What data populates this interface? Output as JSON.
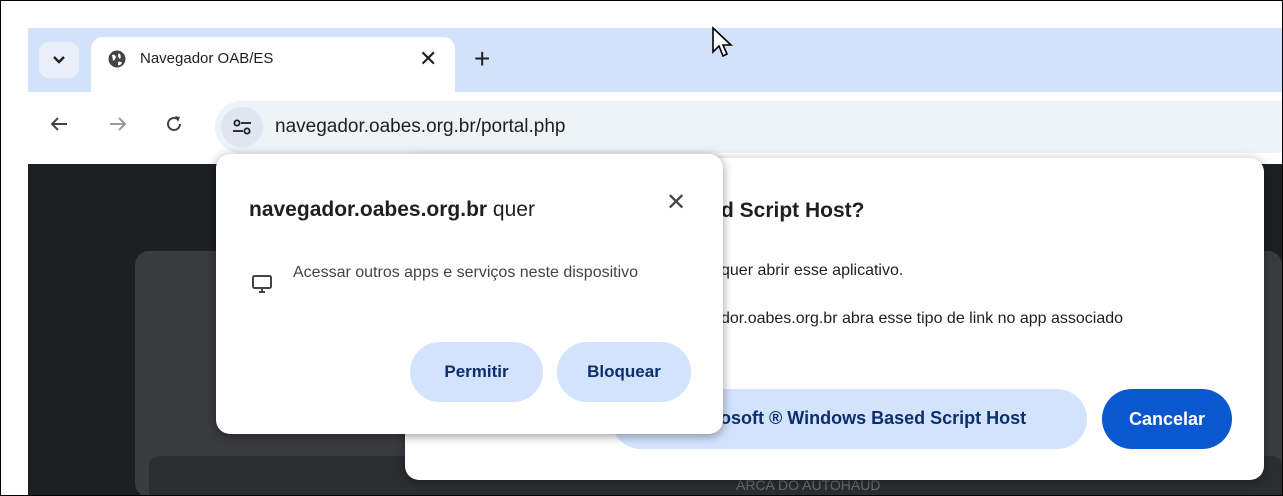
{
  "browser": {
    "tab": {
      "title": "Navegador OAB/ES",
      "close_glyph": "✕"
    },
    "new_tab_glyph": "+",
    "address_bar": {
      "url": "navegador.oabes.org.br/portal.php"
    },
    "icons": {
      "tab_dropdown": "chevron-down-icon",
      "favicon": "globe-icon",
      "back": "arrow-left-icon",
      "forward": "arrow-right-icon",
      "reload": "reload-icon",
      "site_info": "tune-icon"
    }
  },
  "background_page": {
    "partial_text": "ARCA DO AUTOHAUD"
  },
  "protocol_dialog": {
    "title": "d Script Host?",
    "line1": "quer abrir esse aplicativo.",
    "line2": "dor.oabes.org.br abra esse tipo de link no app associado",
    "open_button_label": "rosoft ® Windows Based Script Host",
    "cancel_button_label": "Cancelar"
  },
  "permission_popup": {
    "title_domain": "navegador.oabes.org.br",
    "title_suffix": " quer",
    "close_glyph": "✕",
    "description": "Acessar outros apps e serviços neste dispositivo",
    "allow_label": "Permitir",
    "block_label": "Bloquear",
    "icon": "monitor-icon"
  },
  "colors": {
    "tabbar_bg": "#d3e2fb",
    "primary_button": "#0b57d0",
    "tonal_button": "#d3e3fd",
    "page_bg": "#1e1f22"
  }
}
